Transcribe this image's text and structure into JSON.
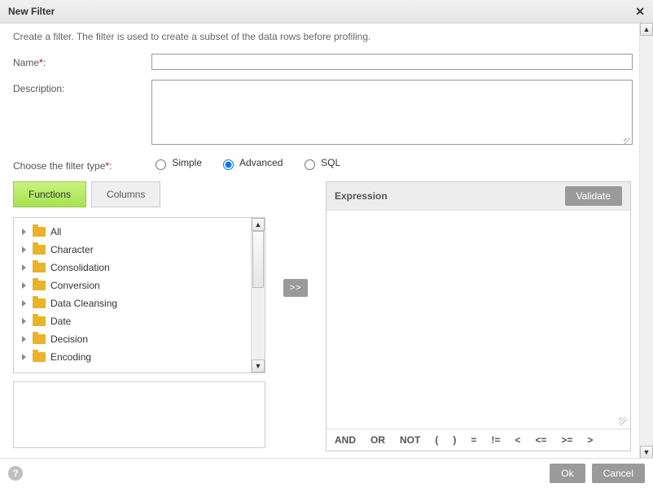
{
  "dialog": {
    "title": "New Filter",
    "close_glyph": "✕"
  },
  "intro": "Create a filter. The filter is used to create a subset of the data rows before profiling.",
  "labels": {
    "name": "Name",
    "description": "Description:",
    "filter_type": "Choose the filter type",
    "required_mark": "*"
  },
  "fields": {
    "name_value": "",
    "description_value": ""
  },
  "filter_type": {
    "options": [
      "Simple",
      "Advanced",
      "SQL"
    ],
    "selected": "Advanced"
  },
  "tabs": {
    "items": [
      "Functions",
      "Columns"
    ],
    "active": "Functions"
  },
  "tree": {
    "items": [
      "All",
      "Character",
      "Consolidation",
      "Conversion",
      "Data Cleansing",
      "Date",
      "Decision",
      "Encoding"
    ]
  },
  "insert": ">>",
  "expression": {
    "title": "Expression",
    "validate": "Validate",
    "operators": [
      "AND",
      "OR",
      "NOT",
      "(",
      ")",
      "=",
      "!=",
      "<",
      "<=",
      ">=",
      ">"
    ]
  },
  "footer": {
    "ok": "Ok",
    "cancel": "Cancel",
    "help_glyph": "?"
  }
}
